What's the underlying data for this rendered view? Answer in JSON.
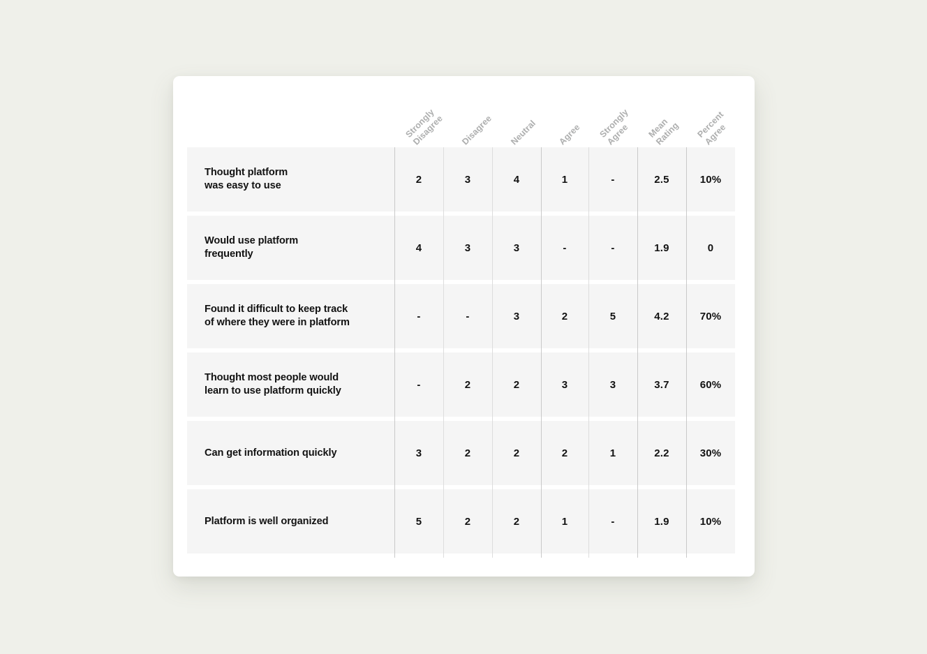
{
  "table": {
    "row_label_header": "",
    "columns": [
      {
        "id": "strongly-disagree",
        "label": "Strongly\nDisagree"
      },
      {
        "id": "disagree",
        "label": "Disagree"
      },
      {
        "id": "neutral",
        "label": "Neutral"
      },
      {
        "id": "agree",
        "label": "Agree"
      },
      {
        "id": "strongly-agree",
        "label": "Strongly\nAgree"
      },
      {
        "id": "mean-rating",
        "label": "Mean\nRating"
      },
      {
        "id": "percent-agree",
        "label": "Percent\nAgree"
      }
    ],
    "rows": [
      {
        "label": "Thought platform\nwas easy to use",
        "values": [
          "2",
          "3",
          "4",
          "1",
          "-",
          "2.5",
          "10%"
        ]
      },
      {
        "label": "Would use platform\nfrequently",
        "values": [
          "4",
          "3",
          "3",
          "-",
          "-",
          "1.9",
          "0"
        ]
      },
      {
        "label": "Found it difficult to keep track\nof where they were in platform",
        "values": [
          "-",
          "-",
          "3",
          "2",
          "5",
          "4.2",
          "70%"
        ]
      },
      {
        "label": "Thought most people would\nlearn to use platform quickly",
        "values": [
          "-",
          "2",
          "2",
          "3",
          "3",
          "3.7",
          "60%"
        ]
      },
      {
        "label": "Can get information quickly",
        "values": [
          "3",
          "2",
          "2",
          "2",
          "1",
          "2.2",
          "30%"
        ]
      },
      {
        "label": "Platform is well organized",
        "values": [
          "5",
          "2",
          "2",
          "1",
          "-",
          "1.9",
          "10%"
        ]
      }
    ]
  },
  "colors": {
    "page_background": "#eff0ea",
    "card_background": "#ffffff",
    "row_band": "#f5f5f5",
    "row_gap": "#ffffff",
    "header_text": "#adaeae",
    "body_text": "#121212",
    "divider": "#dddddd",
    "divider_strong": "#c9c9c9"
  }
}
